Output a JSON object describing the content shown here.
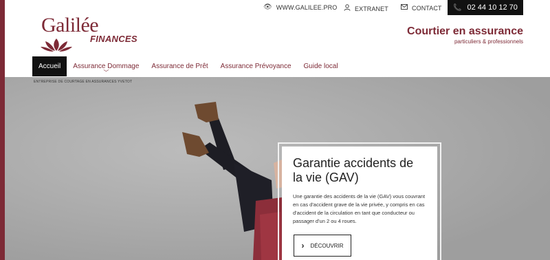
{
  "topbar": {
    "website_label": "WWW.GALILEE.PRO",
    "extranet_label": "EXTRANET",
    "contact_label": "CONTACT",
    "phone": "02 44 10 12 70"
  },
  "logo": {
    "word": "Galilée",
    "sub": "FINANCES"
  },
  "tagline": {
    "title": "Courtier en assurance",
    "subtitle": "particuliers & professionnels"
  },
  "nav": {
    "items": [
      {
        "label": "Accueil"
      },
      {
        "label": "Assurance Dommage"
      },
      {
        "label": "Assurance de Prêt"
      },
      {
        "label": "Assurance Prévoyance"
      },
      {
        "label": "Guide local"
      }
    ]
  },
  "breadcrumb": "ENTREPRISE DE COURTAGE EN ASSURANCES YVETOT",
  "hero_card": {
    "title": "Garantie accidents de la vie (GAV)",
    "text": "Une garantie des accidents de la vie (GAV) vous couvrant en cas d'accident grave de la vie privée, y compris en cas d'accident de la circulation en tant que conducteur ou passager d'un 2 ou 4 roues.",
    "button_label": "DÉCOUVRIR"
  },
  "colors": {
    "brand": "#7d2a36",
    "dark": "#111111"
  },
  "icons": {
    "website": "eye-icon",
    "extranet": "user-icon",
    "contact": "envelope-icon",
    "phone": "phone-icon",
    "button": "chevron-right-icon"
  }
}
